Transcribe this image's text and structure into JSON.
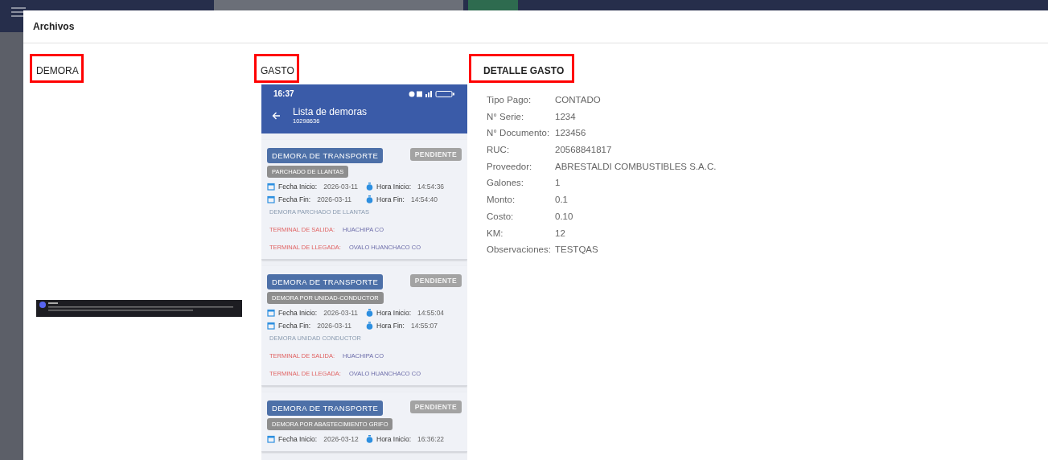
{
  "dialog": {
    "title": "Archivos",
    "demora": {
      "heading": "DEMORA"
    },
    "gasto": {
      "heading": "GASTO",
      "phone": {
        "time": "16:37",
        "title": "Lista de demoras",
        "subtitle": "10298636",
        "cards": [
          {
            "type": "DEMORA DE TRANSPORTE",
            "status": "PENDIENTE",
            "reason": "PARCHADO DE LLANTAS",
            "start_date": {
              "label": "Fecha Inicio:",
              "value": "2026-03-11"
            },
            "start_time": {
              "label": "Hora Inicio:",
              "value": "14:54:36"
            },
            "end_date": {
              "label": "Fecha Fin:",
              "value": "2026-03-11"
            },
            "end_time": {
              "label": "Hora Fin:",
              "value": "14:54:40"
            },
            "description": "DEMORA PARCHADO DE LLANTAS",
            "departure": {
              "label": "TERMINAL DE SALIDA:",
              "value": "HUACHIPA CO"
            },
            "arrival": {
              "label": "TERMINAL DE LLEGADA:",
              "value": "OVALO HUANCHACO CO"
            }
          },
          {
            "type": "DEMORA DE TRANSPORTE",
            "status": "PENDIENTE",
            "reason": "DEMORA POR UNIDAD-CONDUCTOR",
            "start_date": {
              "label": "Fecha Inicio:",
              "value": "2026-03-11"
            },
            "start_time": {
              "label": "Hora Inicio:",
              "value": "14:55:04"
            },
            "end_date": {
              "label": "Fecha Fin:",
              "value": "2026-03-11"
            },
            "end_time": {
              "label": "Hora Fin:",
              "value": "14:55:07"
            },
            "description": "DEMORA UNIDAD CONDUCTOR",
            "departure": {
              "label": "TERMINAL DE SALIDA:",
              "value": "HUACHIPA CO"
            },
            "arrival": {
              "label": "TERMINAL DE LLEGADA:",
              "value": "OVALO HUANCHACO CO"
            }
          },
          {
            "type": "DEMORA DE TRANSPORTE",
            "status": "PENDIENTE",
            "reason": "DEMORA POR ABASTECIMIENTO GRIFO",
            "start_date": {
              "label": "Fecha Inicio:",
              "value": "2026-03-12"
            },
            "start_time": {
              "label": "Hora Inicio:",
              "value": "16:36:22"
            }
          }
        ]
      }
    },
    "detalle": {
      "heading": "DETALLE GASTO",
      "fields": [
        {
          "label": "Tipo Pago:",
          "value": "CONTADO"
        },
        {
          "label": "N° Serie:",
          "value": "1234"
        },
        {
          "label": "N° Documento:",
          "value": "123456"
        },
        {
          "label": "RUC:",
          "value": "20568841817"
        },
        {
          "label": "Proveedor:",
          "value": "ABRESTALDI COMBUSTIBLES S.A.C."
        },
        {
          "label": "Galones:",
          "value": "1"
        },
        {
          "label": "Monto:",
          "value": "0.1"
        },
        {
          "label": "Costo:",
          "value": "0.10"
        },
        {
          "label": "KM:",
          "value": "12"
        },
        {
          "label": "Observaciones:",
          "value": "TESTQAS"
        }
      ]
    }
  }
}
